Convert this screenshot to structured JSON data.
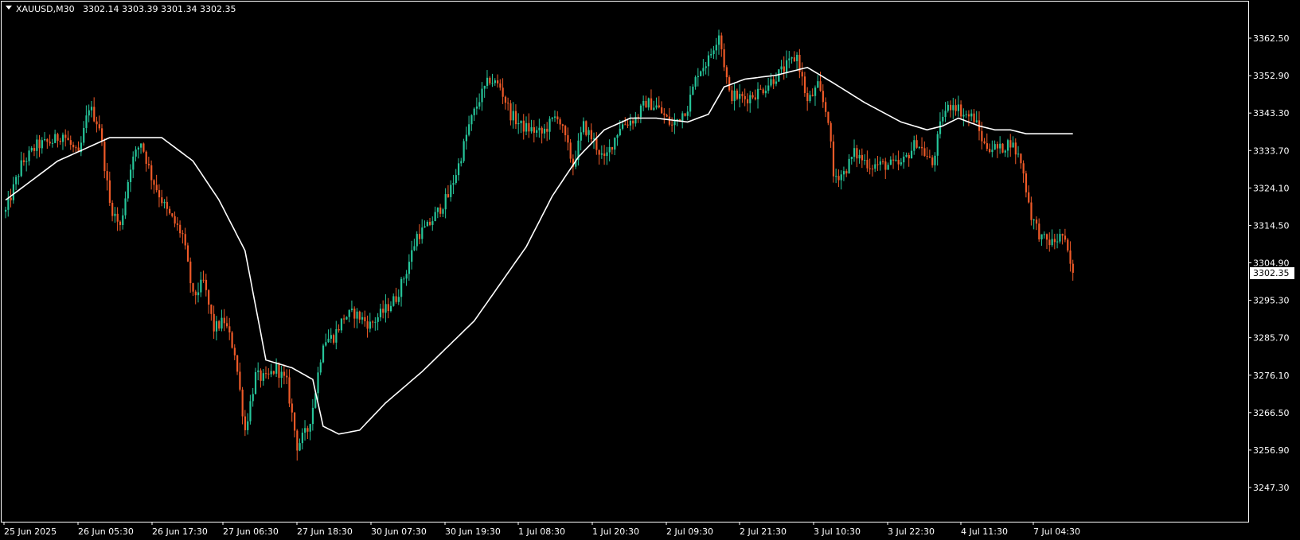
{
  "header": {
    "symbol": "XAUUSD,M30",
    "ohlc": "3302.14 3303.39 3301.34 3302.35"
  },
  "colors": {
    "background": "#000000",
    "bull": "#26c59a",
    "bear": "#ef5a28",
    "ma": "#ffffff",
    "frame": "#ffffff"
  },
  "chart_data": {
    "type": "candlestick",
    "symbol": "XAUUSD",
    "timeframe": "M30",
    "current_price": 3302.35,
    "ylim": [
      3242,
      3370
    ],
    "y_ticks": [
      3362.5,
      3352.9,
      3343.3,
      3333.7,
      3324.1,
      3314.5,
      3304.9,
      3295.3,
      3285.7,
      3276.1,
      3266.5,
      3256.9,
      3247.3
    ],
    "y_tick_labels": [
      "3362.50",
      "3352.90",
      "3343.30",
      "3333.70",
      "3324.10",
      "3314.50",
      "3304.90",
      "3295.30",
      "3285.70",
      "3276.10",
      "3266.50",
      "3256.90",
      "3247.30"
    ],
    "x_labels": [
      "25 Jun 2025",
      "26 Jun 05:30",
      "26 Jun 17:30",
      "27 Jun 06:30",
      "27 Jun 18:30",
      "30 Jun 07:30",
      "30 Jun 19:30",
      "1 Jul 08:30",
      "1 Jul 20:30",
      "2 Jul 09:30",
      "2 Jul 21:30",
      "3 Jul 10:30",
      "3 Jul 22:30",
      "4 Jul 11:30",
      "7 Jul 04:30"
    ],
    "price_path": [
      [
        0,
        3318
      ],
      [
        6,
        3330
      ],
      [
        12,
        3335
      ],
      [
        18,
        3336
      ],
      [
        22,
        3338
      ],
      [
        28,
        3332
      ],
      [
        32,
        3345
      ],
      [
        36,
        3340
      ],
      [
        40,
        3320
      ],
      [
        44,
        3314
      ],
      [
        48,
        3330
      ],
      [
        52,
        3336
      ],
      [
        56,
        3327
      ],
      [
        62,
        3318
      ],
      [
        68,
        3312
      ],
      [
        72,
        3296
      ],
      [
        76,
        3300
      ],
      [
        80,
        3288
      ],
      [
        84,
        3290
      ],
      [
        88,
        3282
      ],
      [
        92,
        3262
      ],
      [
        96,
        3276
      ],
      [
        100,
        3275
      ],
      [
        104,
        3278
      ],
      [
        108,
        3274
      ],
      [
        112,
        3258
      ],
      [
        116,
        3262
      ],
      [
        118,
        3268
      ],
      [
        122,
        3285
      ],
      [
        126,
        3286
      ],
      [
        130,
        3291
      ],
      [
        134,
        3292
      ],
      [
        140,
        3289
      ],
      [
        146,
        3293
      ],
      [
        150,
        3296
      ],
      [
        154,
        3303
      ],
      [
        158,
        3312
      ],
      [
        162,
        3314
      ],
      [
        166,
        3318
      ],
      [
        170,
        3322
      ],
      [
        174,
        3330
      ],
      [
        178,
        3340
      ],
      [
        182,
        3347
      ],
      [
        186,
        3352
      ],
      [
        190,
        3350
      ],
      [
        194,
        3343
      ],
      [
        198,
        3340
      ],
      [
        206,
        3338
      ],
      [
        212,
        3343
      ],
      [
        218,
        3330
      ],
      [
        222,
        3340
      ],
      [
        226,
        3336
      ],
      [
        230,
        3331
      ],
      [
        236,
        3340
      ],
      [
        242,
        3342
      ],
      [
        246,
        3346
      ],
      [
        250,
        3345
      ],
      [
        256,
        3340
      ],
      [
        262,
        3345
      ],
      [
        266,
        3354
      ],
      [
        270,
        3357
      ],
      [
        274,
        3364
      ],
      [
        278,
        3348
      ],
      [
        284,
        3347
      ],
      [
        290,
        3349
      ],
      [
        298,
        3354
      ],
      [
        304,
        3358
      ],
      [
        308,
        3346
      ],
      [
        312,
        3350
      ],
      [
        316,
        3342
      ],
      [
        318,
        3327
      ],
      [
        322,
        3328
      ],
      [
        326,
        3333
      ],
      [
        332,
        3330
      ],
      [
        338,
        3330
      ],
      [
        344,
        3330
      ],
      [
        350,
        3336
      ],
      [
        356,
        3330
      ],
      [
        360,
        3343
      ],
      [
        364,
        3346
      ],
      [
        368,
        3343
      ],
      [
        372,
        3342
      ],
      [
        376,
        3335
      ],
      [
        382,
        3334
      ],
      [
        386,
        3336
      ],
      [
        390,
        3331
      ],
      [
        394,
        3317
      ],
      [
        398,
        3311
      ],
      [
        402,
        3310
      ],
      [
        406,
        3312
      ],
      [
        410,
        3302
      ]
    ],
    "ma_path": [
      [
        0,
        3321
      ],
      [
        10,
        3326
      ],
      [
        20,
        3331
      ],
      [
        40,
        3337
      ],
      [
        60,
        3337
      ],
      [
        72,
        3331
      ],
      [
        82,
        3321
      ],
      [
        92,
        3308
      ],
      [
        100,
        3280
      ],
      [
        110,
        3278
      ],
      [
        118,
        3275
      ],
      [
        122,
        3263
      ],
      [
        128,
        3261
      ],
      [
        136,
        3262
      ],
      [
        146,
        3269
      ],
      [
        160,
        3277
      ],
      [
        180,
        3290
      ],
      [
        200,
        3309
      ],
      [
        210,
        3322
      ],
      [
        220,
        3332
      ],
      [
        230,
        3339
      ],
      [
        240,
        3342
      ],
      [
        250,
        3342
      ],
      [
        262,
        3341
      ],
      [
        270,
        3343
      ],
      [
        276,
        3350
      ],
      [
        284,
        3352
      ],
      [
        296,
        3353
      ],
      [
        308,
        3355
      ],
      [
        318,
        3351
      ],
      [
        330,
        3346
      ],
      [
        344,
        3341
      ],
      [
        354,
        3339
      ],
      [
        360,
        3340
      ],
      [
        366,
        3342
      ],
      [
        374,
        3340
      ],
      [
        380,
        3339
      ],
      [
        386,
        3339
      ],
      [
        392,
        3338
      ],
      [
        400,
        3338
      ],
      [
        410,
        3338
      ]
    ]
  }
}
